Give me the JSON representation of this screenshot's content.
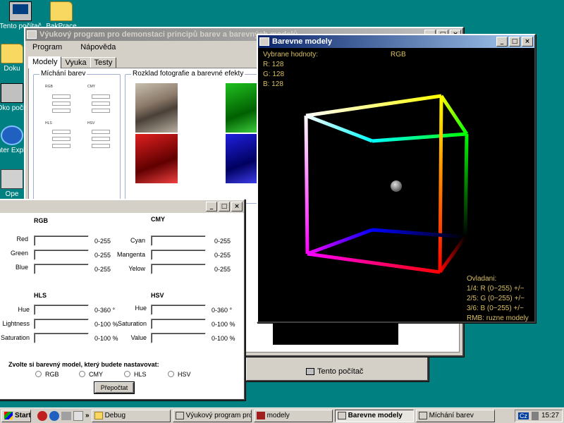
{
  "desktop": {
    "icons": [
      {
        "label": "Tento počítač"
      },
      {
        "label": "BakPrace"
      },
      {
        "label": "Doku"
      },
      {
        "label": "Oko počít"
      },
      {
        "label": "Inter Explo"
      },
      {
        "label": "Ope"
      }
    ]
  },
  "main_window": {
    "title": "Výukový program pro demonstaci principů barev a barevných modelů",
    "menu": [
      "Program",
      "Nápověda"
    ],
    "tabs": [
      "Modely",
      "Vyuka",
      "Testy"
    ],
    "group_left": "Míchání barev",
    "group_right": "Rozklad fotografie a barevné efekty"
  },
  "form_window": {
    "sections": {
      "rgb": "RGB",
      "cmy": "CMY",
      "hls": "HLS",
      "hsv": "HSV"
    },
    "rgb_rows": [
      {
        "label": "Red",
        "range": "0-255"
      },
      {
        "label": "Green",
        "range": "0-255"
      },
      {
        "label": "Blue",
        "range": "0-255"
      }
    ],
    "cmy_rows": [
      {
        "label": "Cyan",
        "range": "0-255"
      },
      {
        "label": "Mangenta",
        "range": "0-255"
      },
      {
        "label": "Yelow",
        "range": "0-255"
      }
    ],
    "hls_rows": [
      {
        "label": "Hue",
        "range": "0-360 °"
      },
      {
        "label": "Lightness",
        "range": "0-100 %"
      },
      {
        "label": "Saturation",
        "range": "0-100 %"
      }
    ],
    "hsv_rows": [
      {
        "label": "Hue",
        "range": "0-360 °"
      },
      {
        "label": "Saturation",
        "range": "0-100 %"
      },
      {
        "label": "Value",
        "range": "0-100 %"
      }
    ],
    "model_prompt": "Zvolte si barevný model, který budete nastavovat:",
    "model_options": [
      "RGB",
      "CMY",
      "HLS",
      "HSV"
    ],
    "recalc_button": "Přepočtat"
  },
  "cube_window": {
    "title": "Barevne modely",
    "selected_label": "Vybrane hodnoty:",
    "model": "RGB",
    "values": [
      "R: 128",
      "G: 128",
      "B: 128"
    ],
    "controls_title": "Ovladani:",
    "controls": [
      "1/4: R (0−255) +/−",
      "2/5: G (0−255) +/−",
      "3/6: B (0−255) +/−",
      "RMB: ruzne modely"
    ]
  },
  "explorer_window": {
    "status": "Tento počítač"
  },
  "taskbar": {
    "start": "Start",
    "quicklaunch_more": "»",
    "tasks": [
      {
        "label": "Debug",
        "active": false
      },
      {
        "label": "Výukový program pro d...",
        "active": false
      },
      {
        "label": "modely",
        "active": false
      },
      {
        "label": "Barevne modely",
        "active": true
      },
      {
        "label": "Míchání barev",
        "active": false
      }
    ],
    "tray_lang": "Cz",
    "clock": "15:27"
  }
}
